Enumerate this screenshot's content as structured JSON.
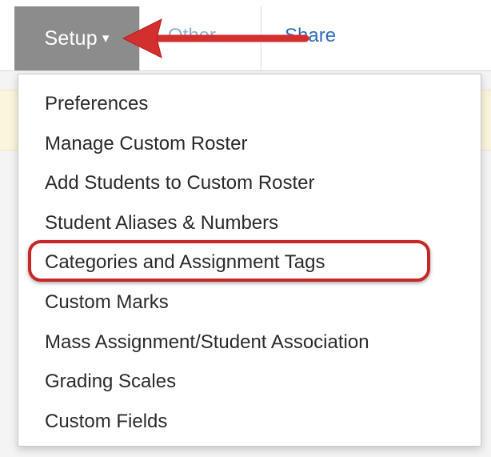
{
  "nav": {
    "setup_label": "Setup",
    "setup_caret": "▾",
    "other_label": "Other",
    "share_label": "Share"
  },
  "menu": {
    "items": [
      {
        "label": "Preferences"
      },
      {
        "label": "Manage Custom Roster"
      },
      {
        "label": "Add Students to Custom Roster"
      },
      {
        "label": "Student Aliases & Numbers"
      },
      {
        "label": "Categories and Assignment Tags"
      },
      {
        "label": "Custom Marks"
      },
      {
        "label": "Mass Assignment/Student Association"
      },
      {
        "label": "Grading Scales"
      },
      {
        "label": "Custom Fields"
      }
    ]
  },
  "annotations": {
    "highlight_color": "#c62828",
    "arrow_color": "#d32f2f"
  }
}
